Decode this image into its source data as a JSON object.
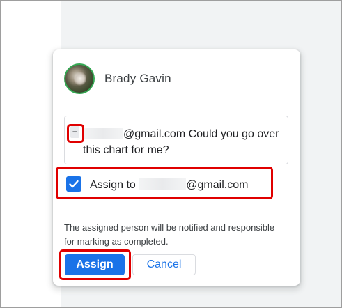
{
  "comment_dialog": {
    "author": {
      "name": "Brady Gavin",
      "avatar_border_color": "#34a853"
    },
    "comment": {
      "mention_prefix": "+",
      "email_suffix": "@gmail.com",
      "message": " Could you go over this chart for me?"
    },
    "assign": {
      "checked": true,
      "label_prefix": "Assign to",
      "email_suffix": "@gmail.com"
    },
    "info_text": "The assigned person will be notified and responsible for marking as completed.",
    "buttons": {
      "assign_label": "Assign",
      "cancel_label": "Cancel"
    },
    "colors": {
      "accent": "#1a73e8",
      "highlight": "#e00000"
    },
    "icons": {
      "checkbox": "check-icon",
      "mention": "plus-icon"
    }
  }
}
